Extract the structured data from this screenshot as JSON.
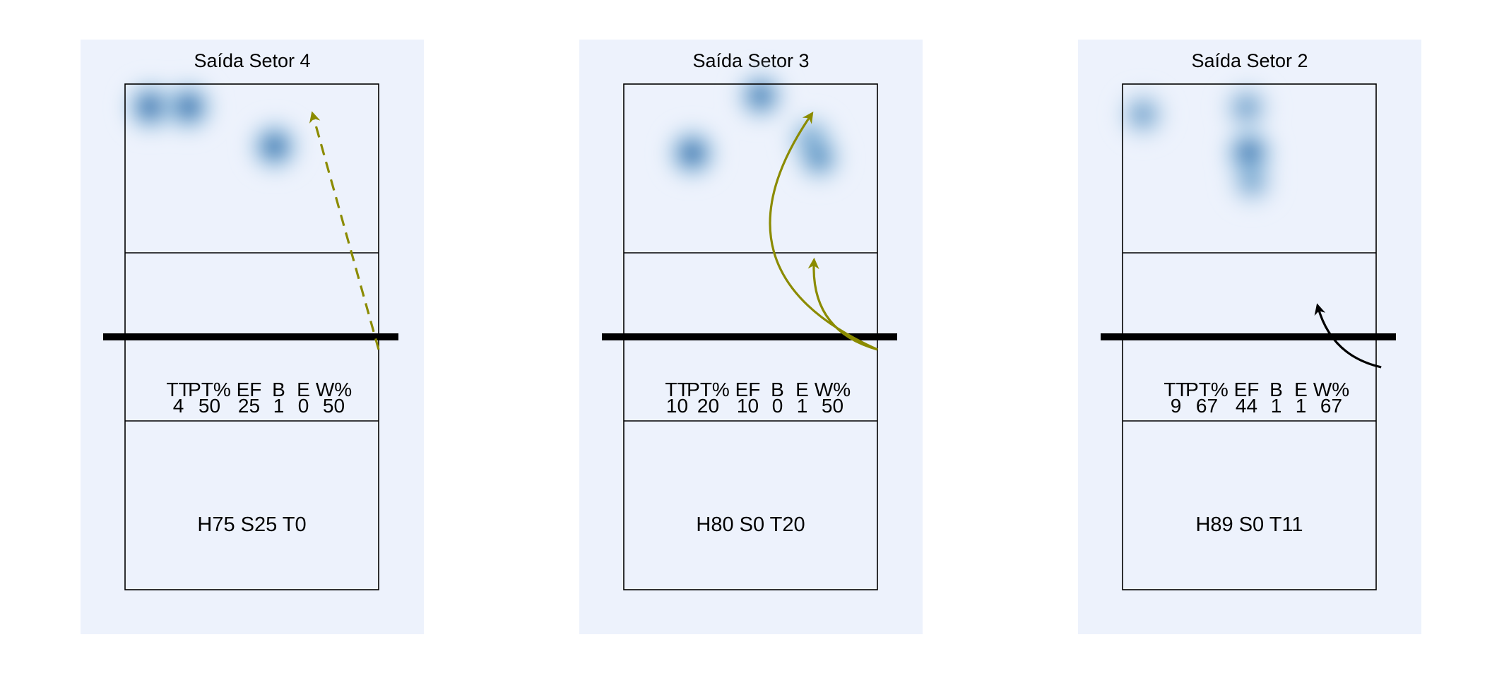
{
  "colors": {
    "panel_background": "#edf2fc",
    "heat_high": "#08519c",
    "heat_low": "#c6dbef",
    "arrow_olive": "#8b8b00",
    "arrow_black": "#000000",
    "net": "#000000"
  },
  "chart_data": [
    {
      "type": "heatmap",
      "title": "Saída Setor 4",
      "stats_headers": [
        "TT",
        "PT%",
        "EF",
        "B",
        "E",
        "W%"
      ],
      "stats_values": [
        "4",
        "50",
        "25",
        "1",
        "0",
        "50"
      ],
      "mix_label": "H75 S25 T0",
      "hotspots": [
        {
          "x": 0.1,
          "y": 0.865,
          "intensity": 0.95
        },
        {
          "x": 0.25,
          "y": 0.865,
          "intensity": 0.95
        },
        {
          "x": 0.59,
          "y": 0.63,
          "intensity": 0.9
        }
      ],
      "arrows": [
        {
          "from": [
            1.0,
            -0.05
          ],
          "to": [
            0.74,
            0.88
          ],
          "curve": 0,
          "dashed": true,
          "color": "arrow_olive"
        }
      ]
    },
    {
      "type": "heatmap",
      "title": "Saída Setor 3",
      "stats_headers": [
        "TT",
        "PT%",
        "EF",
        "B",
        "E",
        "W%"
      ],
      "stats_values": [
        "10",
        "20",
        "10",
        "0",
        "1",
        "50"
      ],
      "mix_label": "H80 S0 T20",
      "hotspots": [
        {
          "x": 0.27,
          "y": 0.59,
          "intensity": 0.95
        },
        {
          "x": 0.54,
          "y": 0.93,
          "intensity": 0.75
        },
        {
          "x": 0.74,
          "y": 0.67,
          "intensity": 0.55
        },
        {
          "x": 0.77,
          "y": 0.56,
          "intensity": 0.55
        }
      ],
      "arrows": [
        {
          "from": [
            1.0,
            -0.05
          ],
          "to": [
            0.75,
            0.3
          ],
          "curve": 40,
          "dashed": false,
          "color": "arrow_olive"
        },
        {
          "from": [
            1.0,
            -0.05
          ],
          "to": [
            0.74,
            0.88
          ],
          "curve": 60,
          "dashed": false,
          "color": "arrow_olive"
        }
      ]
    },
    {
      "type": "heatmap",
      "title": "Saída Setor 2",
      "stats_headers": [
        "TT",
        "PT%",
        "EF",
        "B",
        "E",
        "W%"
      ],
      "stats_values": [
        "9",
        "67",
        "44",
        "1",
        "1",
        "67"
      ],
      "mix_label": "H89 S0 T11",
      "hotspots": [
        {
          "x": 0.08,
          "y": 0.82,
          "intensity": 0.45
        },
        {
          "x": 0.5,
          "y": 0.59,
          "intensity": 0.95
        },
        {
          "x": 0.49,
          "y": 0.86,
          "intensity": 0.45
        },
        {
          "x": 0.51,
          "y": 0.42,
          "intensity": 0.4
        }
      ],
      "arrows": [
        {
          "from": [
            1.02,
            -0.12
          ],
          "to": [
            0.77,
            0.12
          ],
          "curve": 30,
          "dashed": false,
          "color": "arrow_black"
        }
      ]
    }
  ]
}
